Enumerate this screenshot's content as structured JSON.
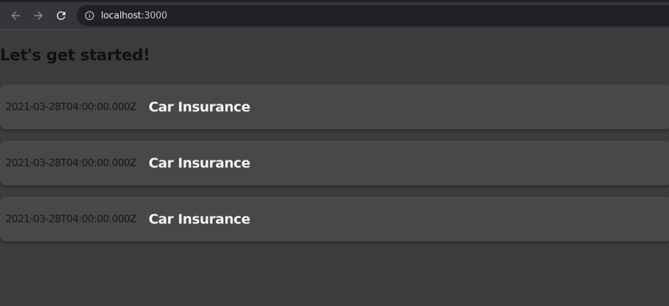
{
  "browser": {
    "url_host": "localhost",
    "url_port": ":3000"
  },
  "page": {
    "heading": "Let's get started!",
    "items": [
      {
        "date": "2021-03-28T04:00:00.000Z",
        "title": "Car Insurance"
      },
      {
        "date": "2021-03-28T04:00:00.000Z",
        "title": "Car Insurance"
      },
      {
        "date": "2021-03-28T04:00:00.000Z",
        "title": "Car Insurance"
      }
    ]
  },
  "colors": {
    "background": "#3c3c3c",
    "card": "#484848",
    "toolbar": "#35363a",
    "omnibox": "#202124"
  }
}
